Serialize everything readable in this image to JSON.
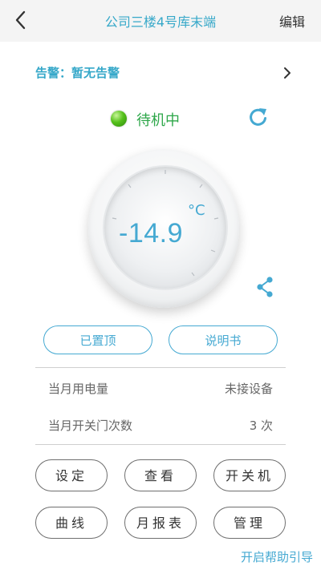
{
  "header": {
    "back_icon": "chevron-left-icon",
    "title": "公司三楼4号库末端",
    "edit_label": "编辑"
  },
  "alarm": {
    "text": "告警：暂无告警",
    "chevron_icon": "chevron-right-icon"
  },
  "status": {
    "text": "待机中",
    "dot_color": "#3fae1a",
    "refresh_icon": "refresh-icon"
  },
  "thermostat": {
    "temperature": "-14.9",
    "unit": "°C",
    "share_icon": "share-icon"
  },
  "buttons": {
    "pin": "已置顶",
    "manual": "说明书"
  },
  "info": [
    {
      "label": "当月用电量",
      "value": "未接设备"
    },
    {
      "label": "当月开关门次数",
      "value": "3 次"
    }
  ],
  "actions": {
    "settings": "设定",
    "view": "查看",
    "power": "开关机",
    "curve": "曲线",
    "monthly_report": "月报表",
    "manage": "管理"
  },
  "help_link": "开启帮助引导",
  "colors": {
    "accent": "#45a9d2",
    "title": "#36a8c9",
    "status_green": "#2ea74a"
  }
}
